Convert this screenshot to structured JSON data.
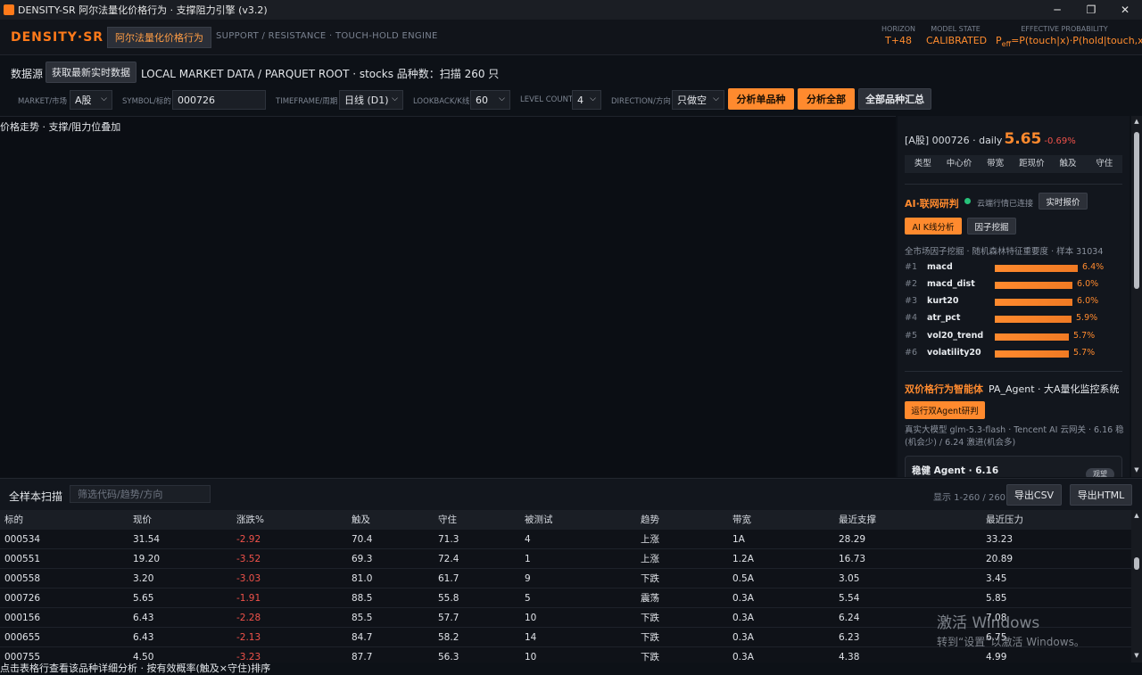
{
  "window": {
    "title": "DENSITY-SR 阿尔法量化价格行为 · 支撑阻力引擎 (v3.2)"
  },
  "header": {
    "brand": "DENSITY·SR",
    "chip": "阿尔法量化价格行为",
    "subtitle": "SUPPORT / RESISTANCE · TOUCH-HOLD ENGINE",
    "horizon_label": "HORIZON",
    "horizon_value": "T+48",
    "model_label": "MODEL STATE",
    "model_value": "CALIBRATED",
    "prob_label": "EFFECTIVE PROBABILITY",
    "prob_value": "P",
    "prob_sub": "eff",
    "prob_formula": "=P(touch|x)·P(hold|touch,x)"
  },
  "datasource": {
    "label": "数据源",
    "fetch_button": "获取最新实时数据",
    "path_text": "LOCAL MARKET DATA / PARQUET ROOT · stocks 品种数：扫描 260 只"
  },
  "controls": {
    "market_label": "MARKET/市场",
    "market_value": "A股",
    "symbol_label": "SYMBOL/标的",
    "symbol_value": "000726",
    "timeframe_label": "TIMEFRAME/周期",
    "timeframe_value": "日线 (D1)",
    "lookback_label": "LOOKBACK/K线",
    "lookback_value": "60",
    "level_label": "LEVEL COUNT",
    "level_value": "4",
    "direction_label": "DIRECTION/方向",
    "direction_value": "只做空",
    "analyze_one": "分析单品种",
    "analyze_all": "分析全部",
    "summary": "全部品种汇总"
  },
  "chart": {
    "title": "价格走势 · 支撑/阻力位叠加"
  },
  "panel": {
    "quote_prefix": "[A股] 000726 · daily",
    "price": "5.65",
    "pct": "-0.69%",
    "level_headers": [
      "类型",
      "中心价",
      "带宽",
      "距现价",
      "触及",
      "守住"
    ],
    "ai_title": "AI·联网研判",
    "cloud_status": "云端行情已连接",
    "realtime_quote": "实时报价",
    "ai_kline": "AI K线分析",
    "factor_mining": "因子挖掘",
    "fi_title": "全市场因子挖掘 · 随机森林特征重要度 · 样本 31034",
    "factors": [
      {
        "rank": "#1",
        "name": "macd",
        "pct": "6.4%",
        "value": 6.4
      },
      {
        "rank": "#2",
        "name": "macd_dist",
        "pct": "6.0%",
        "value": 6.0
      },
      {
        "rank": "#3",
        "name": "kurt20",
        "pct": "6.0%",
        "value": 6.0
      },
      {
        "rank": "#4",
        "name": "atr_pct",
        "pct": "5.9%",
        "value": 5.9
      },
      {
        "rank": "#5",
        "name": "vol20_trend",
        "pct": "5.7%",
        "value": 5.7
      },
      {
        "rank": "#6",
        "name": "volatility20",
        "pct": "5.7%",
        "value": 5.7
      }
    ],
    "agent_title": "双价格行为智能体",
    "agent_subtitle": "PA_Agent · 大A量化监控系统",
    "agent_run": "运行双Agent研判",
    "agent_desc": "真实大模型 glm-5.3-flash · Tencent AI 云网关 · 6.16 稳(机会少) / 6.24 激进(机会多)",
    "agent_card_name": "稳健 Agent · 6.16",
    "agent_card_tag": "观望"
  },
  "scan": {
    "label": "全样本扫描",
    "filter_placeholder": "筛选代码/趋势/方向",
    "count": "显示 1-260 / 260",
    "export_csv": "导出CSV",
    "export_html": "导出HTML"
  },
  "table": {
    "headers": [
      "标的",
      "现价",
      "涨跌%",
      "触及",
      "守住",
      "被测试",
      "趋势",
      "带宽",
      "最近支撑",
      "最近压力"
    ],
    "rows": [
      [
        "000534",
        "31.54",
        "-2.92",
        "70.4",
        "71.3",
        "4",
        "上涨",
        "1A",
        "28.29",
        "33.23"
      ],
      [
        "000551",
        "19.20",
        "-3.52",
        "69.3",
        "72.4",
        "1",
        "上涨",
        "1.2A",
        "16.73",
        "20.89"
      ],
      [
        "000558",
        "3.20",
        "-3.03",
        "81.0",
        "61.7",
        "9",
        "下跌",
        "0.5A",
        "3.05",
        "3.45"
      ],
      [
        "000726",
        "5.65",
        "-1.91",
        "88.5",
        "55.8",
        "5",
        "震荡",
        "0.3A",
        "5.54",
        "5.85"
      ],
      [
        "000156",
        "6.43",
        "-2.28",
        "85.5",
        "57.7",
        "10",
        "下跌",
        "0.3A",
        "6.24",
        "7.08"
      ],
      [
        "000655",
        "6.43",
        "-2.13",
        "84.7",
        "58.2",
        "14",
        "下跌",
        "0.3A",
        "6.23",
        "6.75"
      ],
      [
        "000755",
        "4.50",
        "-3.23",
        "87.7",
        "56.3",
        "10",
        "下跌",
        "0.3A",
        "4.38",
        "4.99"
      ]
    ]
  },
  "status": {
    "text": "点击表格行查看该品种详细分析 · 按有效概率(触及×守住)排序"
  },
  "watermark": {
    "line1": "激活 Windows",
    "line2": "转到“设置”以激活 Windows。"
  },
  "colors": {
    "accent": "#ff8a2e",
    "negative": "#f0524a",
    "online": "#27c27a"
  }
}
